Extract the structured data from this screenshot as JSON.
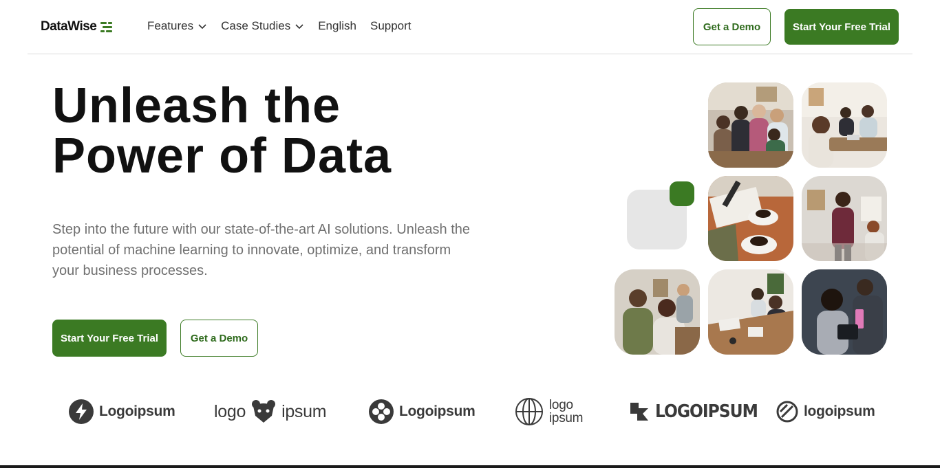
{
  "brand": {
    "name": "DataWise",
    "icon": "stacked-bars-icon",
    "accent_color": "#3b7a23"
  },
  "nav": {
    "items": [
      {
        "label": "Features",
        "has_dropdown": true
      },
      {
        "label": "Case Studies",
        "has_dropdown": true
      },
      {
        "label": "English",
        "has_dropdown": false
      },
      {
        "label": "Support",
        "has_dropdown": false
      }
    ]
  },
  "header_actions": {
    "demo_label": "Get a Demo",
    "trial_label": "Start Your Free Trial"
  },
  "hero": {
    "title": "Unleash the\nPower of Data",
    "subtitle": "Step into the future with our state-of-the-art AI solutions. Unleash the potential of machine learning to innovate, optimize, and transform your business processes.",
    "trial_label": "Start Your Free Trial",
    "demo_label": "Get a Demo"
  },
  "gallery": {
    "photos": [
      "team-huddle-photo",
      "meeting-table-photo",
      "coffee-notes-photo",
      "presenter-photo",
      "laughing-colleagues-photo",
      "workshop-table-photo",
      "tablet-review-photo"
    ]
  },
  "logos": [
    {
      "text": "Logoipsum",
      "icon": "bolt-circle-icon"
    },
    {
      "text_left": "logo",
      "text_right": "ipsum",
      "icon": "bear-icon"
    },
    {
      "text": "Logoipsum",
      "icon": "four-dots-circle-icon"
    },
    {
      "text_top": "logo",
      "text_bottom": "ipsum",
      "icon": "globe-icon"
    },
    {
      "text": "LOGOIPSUM",
      "icon": "angled-shape-icon"
    },
    {
      "text": "logoipsum",
      "icon": "slashed-circle-icon"
    }
  ]
}
